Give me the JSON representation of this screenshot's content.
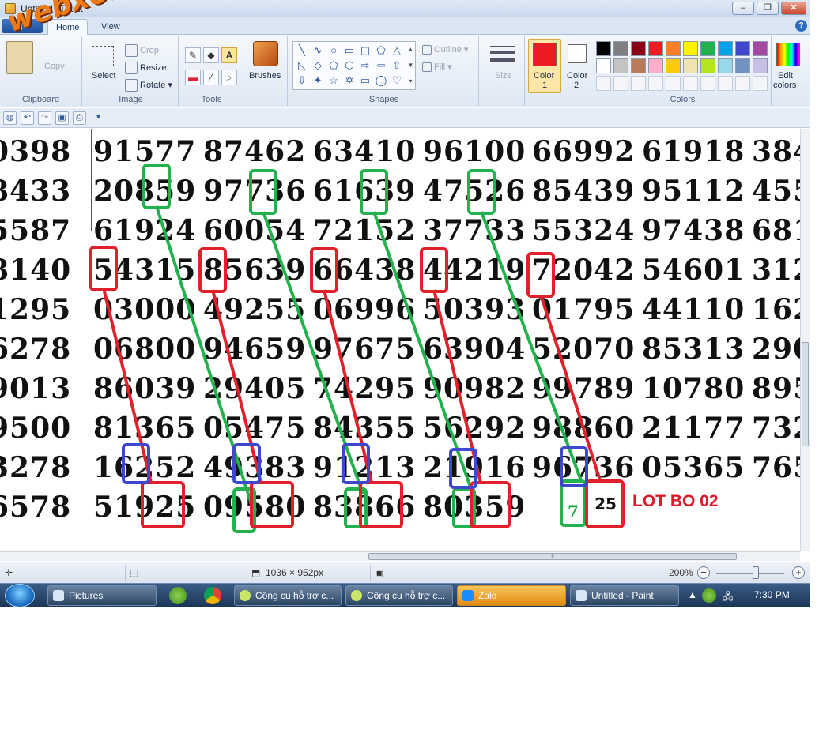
{
  "window": {
    "title": "Untitled - Paint",
    "controls": [
      "–",
      "❐",
      "✕"
    ],
    "help": "?"
  },
  "tabs": {
    "app_menu": "▤ ▾",
    "items": [
      "Home",
      "View"
    ]
  },
  "ribbon": {
    "clipboard": {
      "label": "Clipboard",
      "copy": "Copy"
    },
    "image": {
      "label": "Image",
      "select": "Select",
      "crop": "Crop",
      "resize": "Resize",
      "rotate": "Rotate ▾"
    },
    "tools": {
      "label": "Tools"
    },
    "brushes": {
      "label": "Brushes"
    },
    "shapes": {
      "label": "Shapes",
      "outline": "Outline ▾",
      "fill": "Fill ▾"
    },
    "size": {
      "label": "Size"
    },
    "color1": {
      "label": "Color",
      "num": "1",
      "value": "#ed1c24"
    },
    "color2": {
      "label": "Color",
      "num": "2",
      "value": "#ffffff"
    },
    "colors": {
      "label": "Colors",
      "row1": [
        "#000000",
        "#7f7f7f",
        "#880015",
        "#ed1c24",
        "#ff7f27",
        "#fff200",
        "#22b14c",
        "#00a2e8",
        "#3f48cc",
        "#a349a4"
      ],
      "row2": [
        "#ffffff",
        "#c3c3c3",
        "#b97a57",
        "#ffaec9",
        "#ffc90e",
        "#efe4b0",
        "#b5e61d",
        "#99d9ea",
        "#7092be",
        "#c8bfe7"
      ]
    },
    "edit_colors": {
      "label": "Edit",
      "label2": "colors"
    }
  },
  "watermark": "webxoso.net",
  "table": {
    "left_column": [
      "0398",
      "8433",
      "5587",
      "8140",
      "1295",
      "6278",
      "9013",
      "9500",
      "3278",
      "6578"
    ],
    "rows": [
      [
        "91577",
        "87462",
        "63410",
        "96100",
        "66992",
        "61918",
        "384"
      ],
      [
        "20859",
        "97736",
        "61639",
        "47526",
        "85439",
        "95112",
        "455"
      ],
      [
        "61924",
        "60054",
        "72152",
        "37733",
        "55324",
        "97438",
        "681"
      ],
      [
        "54315",
        "85639",
        "66438",
        "44219",
        "72042",
        "54601",
        "312"
      ],
      [
        "03000",
        "49255",
        "06996",
        "50393",
        "01795",
        "44110",
        "162"
      ],
      [
        "06800",
        "94659",
        "97675",
        "63904",
        "52070",
        "85313",
        "290"
      ],
      [
        "86039",
        "29405",
        "74295",
        "90982",
        "99789",
        "10780",
        "895"
      ],
      [
        "81365",
        "05475",
        "84355",
        "56292",
        "98860",
        "21177",
        "732"
      ],
      [
        "16252",
        "49383",
        "91213",
        "21916",
        "96736",
        "05365",
        "765"
      ],
      [
        "51925",
        "09580",
        "83866",
        "80359",
        "",
        "",
        ""
      ]
    ],
    "result_green": "7",
    "result_black": "25",
    "lot_label": "LOT BO 02"
  },
  "status": {
    "dimensions": "1036 × 952px",
    "zoom": "200%"
  },
  "taskbar": {
    "tasks": [
      {
        "label": "Pictures"
      },
      {
        "label": "Công cụ hỗ trợ c..."
      },
      {
        "label": "Công cụ hỗ trợ c..."
      },
      {
        "label": "Zalo"
      },
      {
        "label": "Untitled - Paint"
      }
    ],
    "clock": "7:30 PM"
  }
}
